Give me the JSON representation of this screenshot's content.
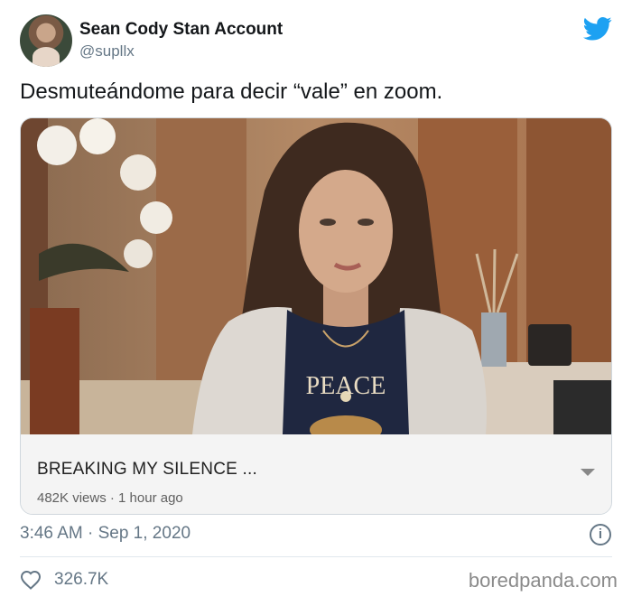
{
  "tweet": {
    "author_name": "Sean Cody Stan Account",
    "handle": "@supllx",
    "text": "Desmuteándome para decir “vale” en zoom.",
    "timestamp": "3:46 AM · Sep 1, 2020",
    "likes": "326.7K"
  },
  "card": {
    "video_title": "BREAKING MY SILENCE ...",
    "video_subtitle": "482K views · 1 hour ago",
    "shirt_text": "PEACE"
  },
  "watermark": "boredpanda.com",
  "colors": {
    "twitter_blue": "#1da1f2",
    "secondary_text": "#657786"
  },
  "icons": [
    "twitter-bird-icon",
    "info-icon",
    "heart-icon",
    "dropdown-caret-icon"
  ]
}
